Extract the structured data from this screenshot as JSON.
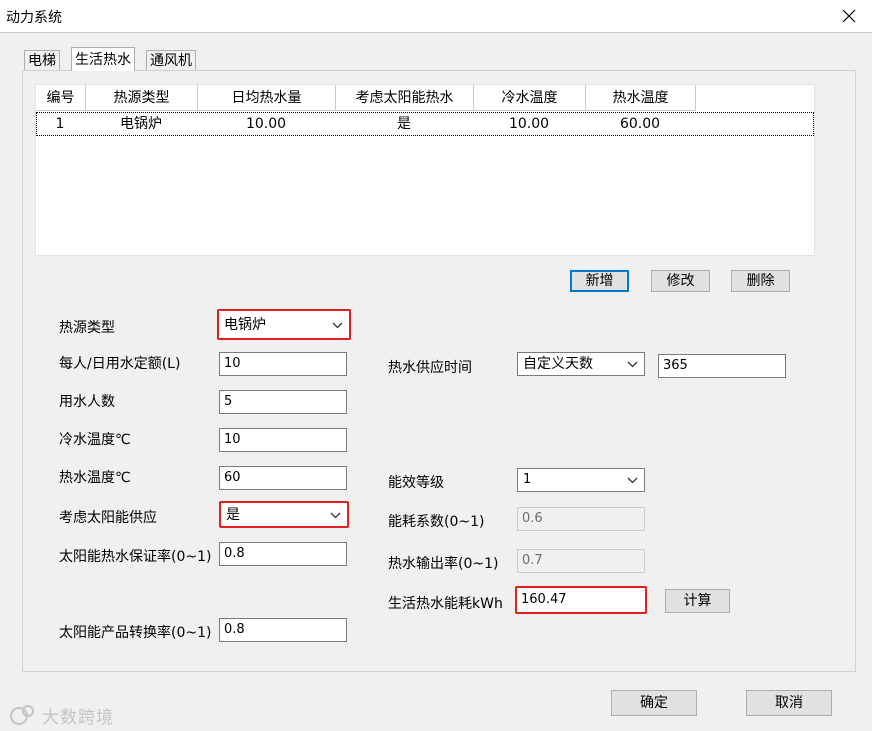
{
  "window": {
    "title": "动力系统"
  },
  "tabs": [
    {
      "label": "电梯",
      "active": false
    },
    {
      "label": "生活热水",
      "active": true
    },
    {
      "label": "通风机",
      "active": false
    }
  ],
  "grid": {
    "columns": [
      "编号",
      "热源类型",
      "日均热水量",
      "考虑太阳能热水",
      "冷水温度",
      "热水温度"
    ],
    "rows": [
      [
        "1",
        "电锅炉",
        "10.00",
        "是",
        "10.00",
        "60.00"
      ]
    ]
  },
  "grid_buttons": {
    "add": "新增",
    "edit": "修改",
    "delete": "删除"
  },
  "form": {
    "heat_source_label": "热源类型",
    "heat_source_value": "电锅炉",
    "water_quota_label": "每人/日用水定额(L)",
    "water_quota_value": "10",
    "users_label": "用水人数",
    "users_value": "5",
    "cold_temp_label": "冷水温度℃",
    "cold_temp_value": "10",
    "hot_temp_label": "热水温度℃",
    "hot_temp_value": "60",
    "solar_label": "考虑太阳能供应",
    "solar_value": "是",
    "solar_guarantee_label": "太阳能热水保证率(0~1)",
    "solar_guarantee_value": "0.8",
    "solar_conversion_label": "太阳能产品转换率(0~1)",
    "solar_conversion_value": "0.8",
    "supply_time_label": "热水供应时间",
    "supply_time_mode": "自定义天数",
    "supply_days_value": "365",
    "efficiency_grade_label": "能效等级",
    "efficiency_grade_value": "1",
    "energy_coef_label": "能耗系数(0~1)",
    "energy_coef_value": "0.6",
    "output_rate_label": "热水输出率(0~1)",
    "output_rate_value": "0.7",
    "energy_use_label": "生活热水能耗kWh",
    "energy_use_value": "160.47",
    "calc_button": "计算"
  },
  "footer": {
    "ok": "确定",
    "cancel": "取消"
  },
  "watermark": {
    "text": "大数跨境"
  },
  "colors": {
    "highlight": "#e02020",
    "default_button_border": "#0078d7"
  }
}
